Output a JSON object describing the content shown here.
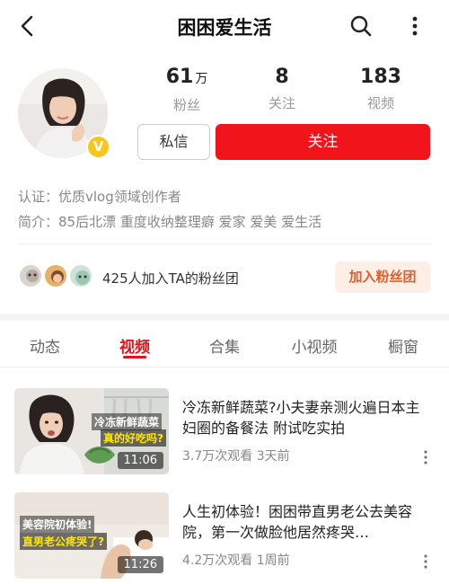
{
  "header": {
    "title": "困困爱生活"
  },
  "profile": {
    "badge": "V",
    "stats": [
      {
        "value": "61",
        "unit": "万",
        "label": "粉丝"
      },
      {
        "value": "8",
        "unit": "",
        "label": "关注"
      },
      {
        "value": "183",
        "unit": "",
        "label": "视频"
      }
    ],
    "message_button": "私信",
    "follow_button": "关注",
    "certification": "认证：优质vlog领域创作者",
    "bio": "简介：85后北漂 重度收纳整理癖 爱家 爱美 爱生活"
  },
  "fan_group": {
    "text": "425人加入TA的粉丝团",
    "join_button": "加入粉丝团"
  },
  "tabs": [
    {
      "label": "动态",
      "active": false
    },
    {
      "label": "视频",
      "active": true
    },
    {
      "label": "合集",
      "active": false
    },
    {
      "label": "小视频",
      "active": false
    },
    {
      "label": "橱窗",
      "active": false
    }
  ],
  "videos": [
    {
      "title": "冷冻新鲜蔬菜?小夫妻亲测火遍日本主妇圈的备餐法 附试吃实拍",
      "duration": "11:06",
      "meta": "3.7万次观看 3天前",
      "thumb_text_1": "冷冻新鲜蔬菜",
      "thumb_text_2": "真的好吃吗?"
    },
    {
      "title": "人生初体验！困困带直男老公去美容院，第一次做脸他居然疼哭…",
      "duration": "11:26",
      "meta": "4.2万次观看 1周前",
      "thumb_text_1": "美容院初体验!",
      "thumb_text_2": "直男老公疼哭了?"
    }
  ],
  "colors": {
    "accent_red": "#f2141b",
    "tab_active": "#e0141b",
    "join_bg": "#fdeee6",
    "join_text": "#e35d2b",
    "badge_yellow": "#f6c61a"
  },
  "icons": [
    "back-arrow-icon",
    "search-icon",
    "more-vertical-icon",
    "verified-v-icon",
    "more-dots-icon"
  ]
}
